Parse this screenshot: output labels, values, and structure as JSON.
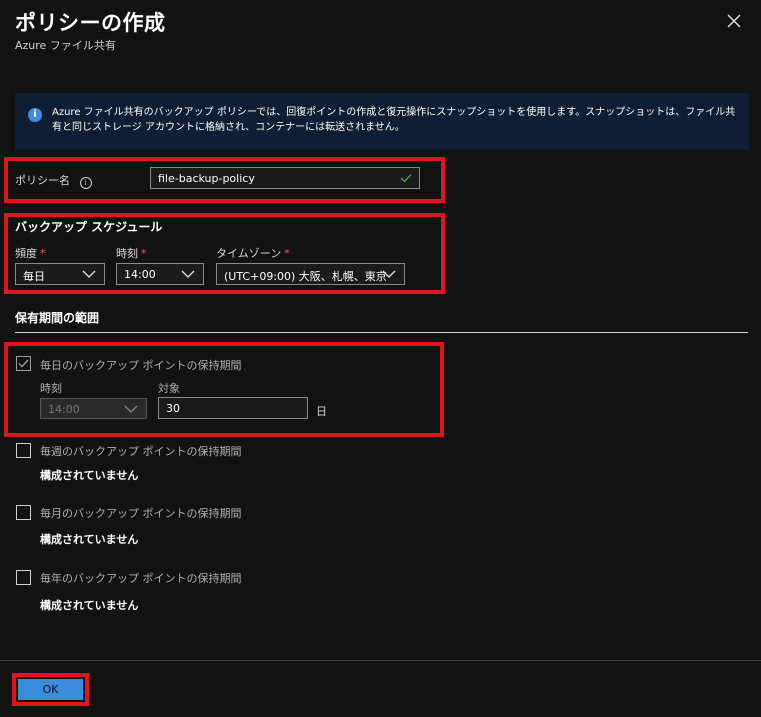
{
  "header": {
    "title": "ポリシーの作成",
    "subtitle": "Azure ファイル共有",
    "close_icon": "close-icon"
  },
  "info": {
    "icon": "info-icon",
    "icon_glyph": "i",
    "text": "Azure ファイル共有のバックアップ ポリシーでは、回復ポイントの作成と復元操作にスナップショットを使用します。スナップショットは、ファイル共有と同じストレージ アカウントに格納され、コンテナーには転送されません。"
  },
  "policy": {
    "label": "ポリシー名",
    "value": "file-backup-policy",
    "valid_icon": "checkmark-icon"
  },
  "schedule": {
    "heading": "バックアップ スケジュール",
    "frequency_label": "頻度",
    "frequency_value": "毎日",
    "time_label": "時刻",
    "time_value": "14:00",
    "timezone_label": "タイムゾーン",
    "timezone_value": "(UTC+09:00) 大阪、札幌、東京",
    "required_mark": "*"
  },
  "retention": {
    "heading": "保有期間の範囲",
    "daily": {
      "label": "毎日のバックアップ ポイントの保持期間",
      "checked": true,
      "time_label": "時刻",
      "time_value": "14:00",
      "target_label": "対象",
      "target_value": "30",
      "unit": "日"
    },
    "weekly": {
      "label": "毎週のバックアップ ポイントの保持期間",
      "status": "構成されていません",
      "checked": false
    },
    "monthly": {
      "label": "毎月のバックアップ ポイントの保持期間",
      "status": "構成されていません",
      "checked": false
    },
    "yearly": {
      "label": "毎年のバックアップ ポイントの保持期間",
      "status": "構成されていません",
      "checked": false
    }
  },
  "footer": {
    "ok_label": "OK"
  },
  "colors": {
    "accent": "#3a8dde",
    "highlight": "#e0161f",
    "background": "#121212",
    "info_bg": "#0e1f33",
    "required": "#ff5a5a",
    "valid": "#4caf50"
  }
}
